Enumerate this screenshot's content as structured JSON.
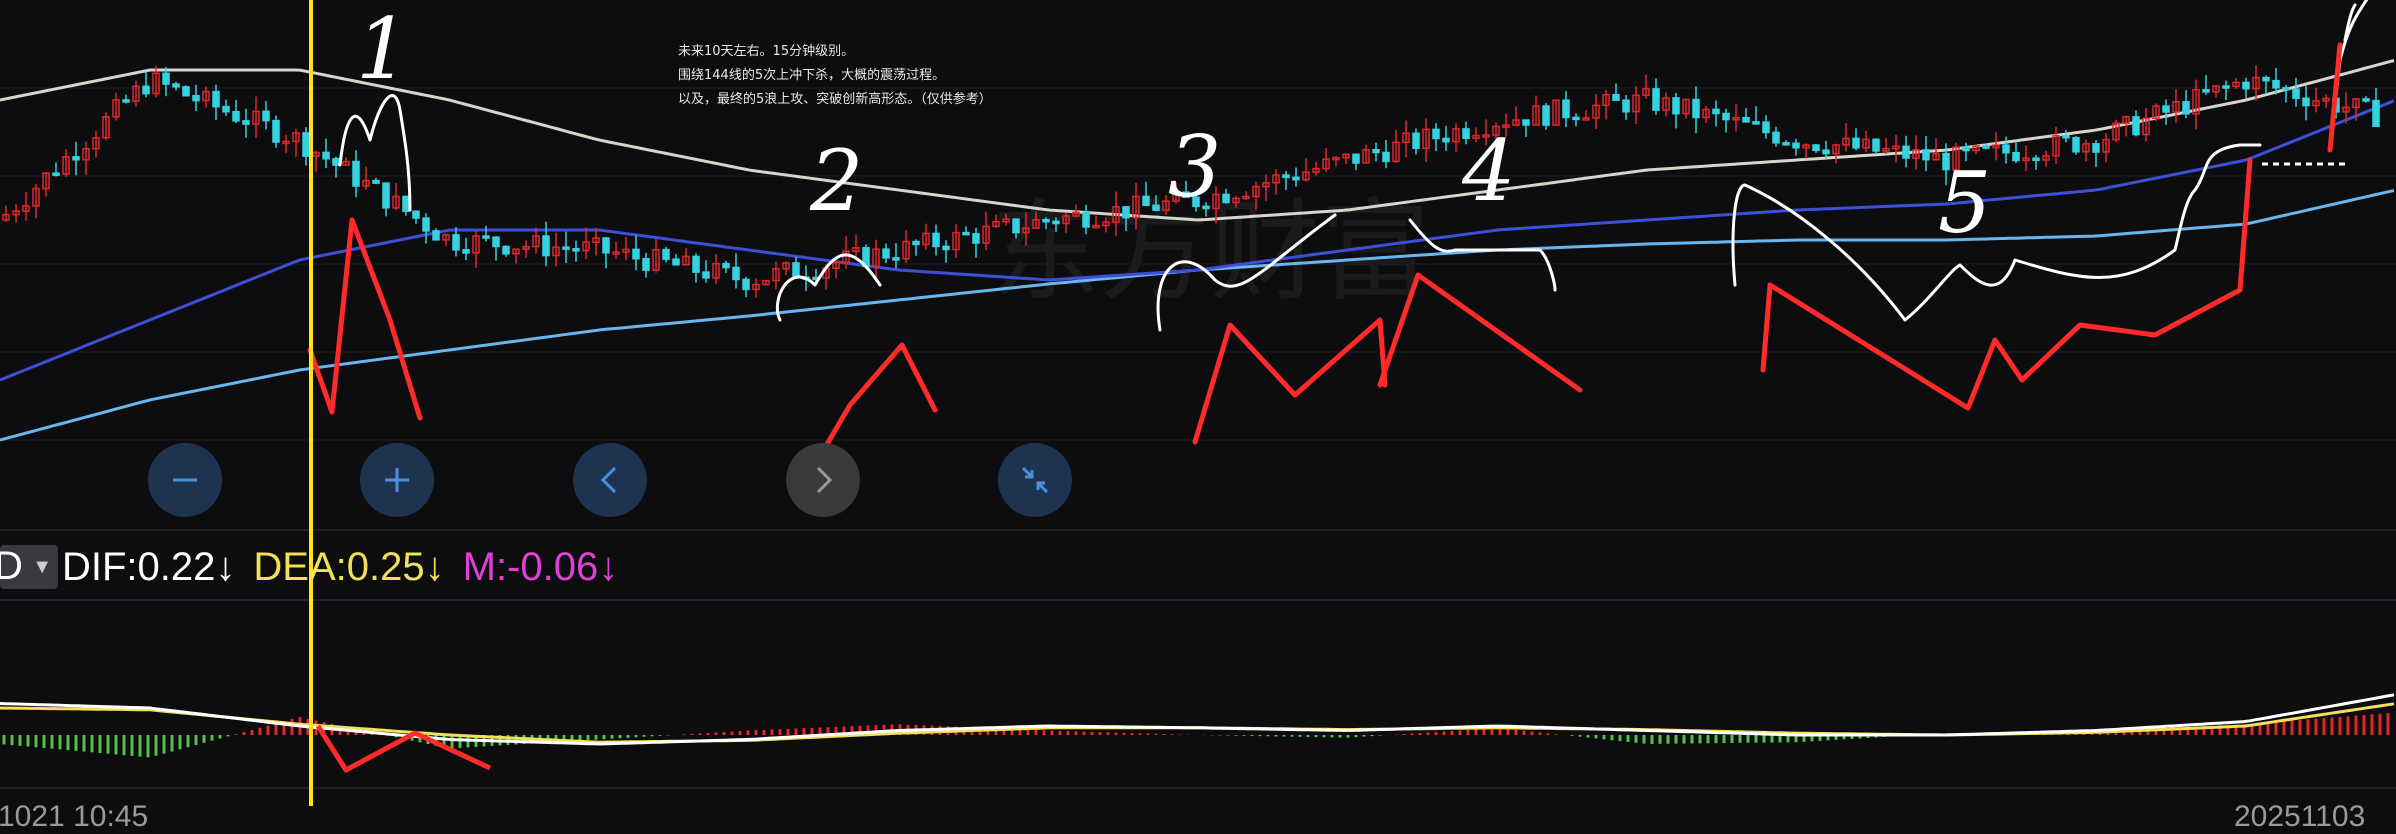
{
  "note": {
    "line1": "未来10天左右。15分钟级别。",
    "line2": "围绕144线的5次上冲下杀，大概的震荡过程。",
    "line3": "以及，最终的5浪上攻、突破创新高形态。（仅供参考）"
  },
  "watermark": "东方财富",
  "indicator_selector": "D",
  "macd_stats": {
    "dif": "DIF:0.22",
    "dea": "DEA:0.25",
    "m": "M:-0.06",
    "arrow": "↓",
    "dif_color": "#ffffff",
    "dea_color": "#f2e05a",
    "m_color": "#e040d8"
  },
  "wave_labels": [
    "1",
    "2",
    "3",
    "4",
    "5"
  ],
  "controls": {
    "zoom_out_icon": "minus-icon",
    "zoom_in_icon": "plus-icon",
    "prev_icon": "chevron-left-icon",
    "next_icon": "chevron-right-icon",
    "reset_icon": "compress-icon"
  },
  "time_axis": {
    "left_label": "1021 10:45",
    "right_label": "20251103"
  },
  "colors": {
    "background": "#0d0d0f",
    "up_candle": "#e0282a",
    "down_candle": "#35d2e0",
    "ma_short": "#d8d4cc",
    "ma_mid": "#3c4fd6",
    "ma_long": "#68b6f0",
    "annotation": "#ff2a2a",
    "cursor_line": "#ffe21a"
  },
  "chart_data": [
    {
      "type": "candlestick",
      "title": "",
      "xlabel": "",
      "ylabel": "",
      "series": [
        {
          "values": [
            0.2,
            0.9,
            0.6,
            0.1,
            0.05,
            -0.1,
            0.05,
            0.2,
            0.3,
            0.5,
            0.7,
            0.8,
            0.6,
            0.5,
            0.6,
            0.9,
            0.7
          ]
        },
        {
          "values": [
            0.8,
            0.95,
            0.95,
            0.8,
            0.6,
            0.45,
            0.35,
            0.25,
            0.2,
            0.25,
            0.35,
            0.45,
            0.5,
            0.55,
            0.65,
            0.8,
            1.0
          ]
        },
        {
          "values": [
            -0.6,
            -0.3,
            0.0,
            0.15,
            0.15,
            0.05,
            -0.05,
            -0.1,
            -0.05,
            0.05,
            0.15,
            0.2,
            0.25,
            0.28,
            0.35,
            0.5,
            0.8
          ]
        },
        {
          "values": [
            -0.9,
            -0.7,
            -0.55,
            -0.45,
            -0.35,
            -0.28,
            -0.2,
            -0.12,
            -0.05,
            0.0,
            0.05,
            0.08,
            0.1,
            0.1,
            0.12,
            0.18,
            0.35
          ]
        }
      ]
    },
    {
      "type": "line",
      "title": "",
      "xlabel": "",
      "ylabel": "",
      "series": [
        {
          "name": "DIF",
          "values": [
            0.35,
            0.3,
            0.1,
            -0.05,
            -0.1,
            -0.05,
            0.05,
            0.1,
            0.08,
            0.05,
            0.1,
            0.05,
            0.0,
            0.0,
            0.05,
            0.15,
            0.45
          ]
        },
        {
          "name": "DEA",
          "values": [
            0.3,
            0.28,
            0.12,
            0.0,
            -0.08,
            -0.06,
            0.02,
            0.08,
            0.08,
            0.06,
            0.08,
            0.06,
            0.02,
            0.0,
            0.03,
            0.1,
            0.35
          ]
        },
        {
          "name": "M",
          "values": [
            -0.1,
            -0.25,
            0.2,
            -0.15,
            -0.05,
            0.05,
            0.12,
            0.05,
            0.0,
            -0.03,
            0.08,
            -0.1,
            -0.08,
            0.02,
            0.05,
            0.12,
            0.25
          ]
        }
      ]
    }
  ]
}
